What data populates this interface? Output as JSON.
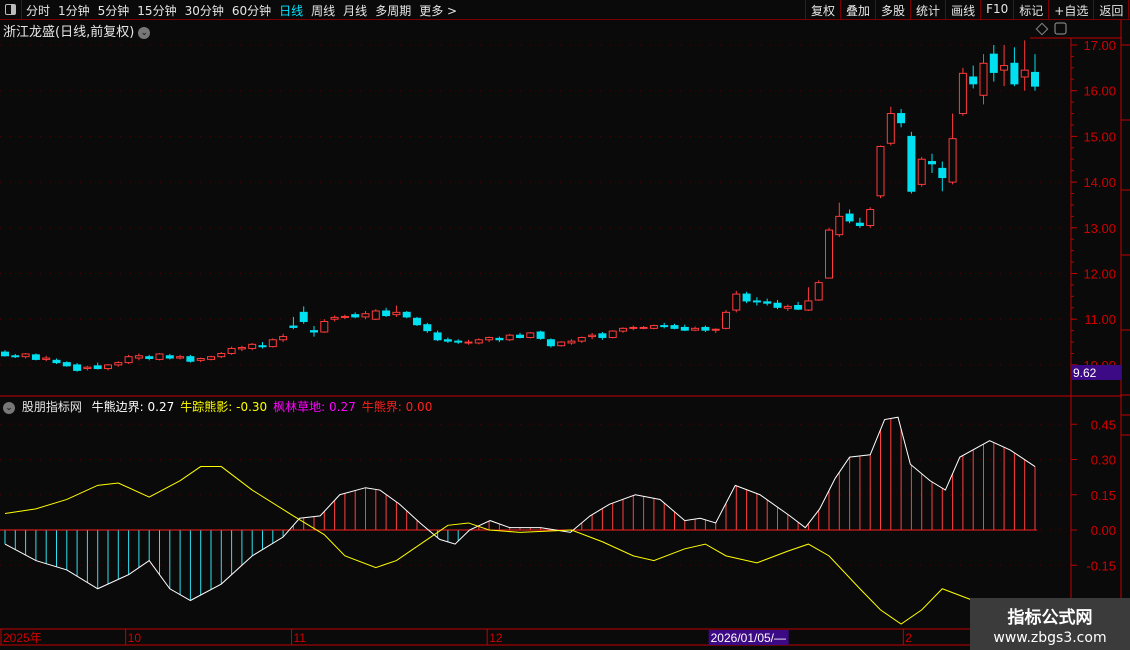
{
  "toolbar": {
    "periods": [
      "分时",
      "1分钟",
      "5分钟",
      "15分钟",
      "30分钟",
      "60分钟",
      "日线",
      "周线",
      "月线",
      "多周期",
      "更多 >"
    ],
    "active_period": "日线",
    "buttons": [
      "复权",
      "叠加",
      "多股",
      "统计",
      "画线",
      "F10",
      "标记",
      "+自选",
      "返回"
    ]
  },
  "chart": {
    "title": "浙江龙盛(日线,前复权)",
    "price_axis": [
      "17.00",
      "16.00",
      "15.00",
      "14.00",
      "13.00",
      "12.00",
      "11.00",
      "10.00"
    ],
    "price_range": [
      9.62,
      17.0
    ],
    "current_price_label": "9.62",
    "colors": {
      "up": "#ff3b3b",
      "down": "#00e0f0",
      "axis": "#c00000",
      "bg": "#0a0a0a"
    },
    "candles_ohlc": [
      [
        10.28,
        10.32,
        10.18,
        10.2
      ],
      [
        10.2,
        10.24,
        10.15,
        10.18
      ],
      [
        10.18,
        10.26,
        10.14,
        10.24
      ],
      [
        10.22,
        10.25,
        10.1,
        10.12
      ],
      [
        10.12,
        10.2,
        10.08,
        10.15
      ],
      [
        10.1,
        10.14,
        10.02,
        10.05
      ],
      [
        10.05,
        10.08,
        9.96,
        9.98
      ],
      [
        10.0,
        10.04,
        9.85,
        9.88
      ],
      [
        9.92,
        9.98,
        9.88,
        9.95
      ],
      [
        9.98,
        10.05,
        9.9,
        9.92
      ],
      [
        9.92,
        10.02,
        9.88,
        10.0
      ],
      [
        10.0,
        10.08,
        9.96,
        10.05
      ],
      [
        10.05,
        10.22,
        10.02,
        10.18
      ],
      [
        10.15,
        10.25,
        10.1,
        10.2
      ],
      [
        10.18,
        10.22,
        10.1,
        10.14
      ],
      [
        10.12,
        10.26,
        10.1,
        10.24
      ],
      [
        10.2,
        10.24,
        10.12,
        10.15
      ],
      [
        10.15,
        10.22,
        10.12,
        10.18
      ],
      [
        10.18,
        10.22,
        10.05,
        10.08
      ],
      [
        10.1,
        10.16,
        10.06,
        10.14
      ],
      [
        10.12,
        10.2,
        10.1,
        10.18
      ],
      [
        10.18,
        10.28,
        10.15,
        10.25
      ],
      [
        10.25,
        10.4,
        10.22,
        10.36
      ],
      [
        10.35,
        10.42,
        10.3,
        10.38
      ],
      [
        10.36,
        10.48,
        10.32,
        10.45
      ],
      [
        10.42,
        10.5,
        10.36,
        10.4
      ],
      [
        10.4,
        10.58,
        10.38,
        10.55
      ],
      [
        10.55,
        10.68,
        10.5,
        10.62
      ],
      [
        10.85,
        11.05,
        10.78,
        10.82
      ],
      [
        11.15,
        11.28,
        10.9,
        10.95
      ],
      [
        10.75,
        10.85,
        10.62,
        10.72
      ],
      [
        10.72,
        11.0,
        10.7,
        10.95
      ],
      [
        11.0,
        11.08,
        10.95,
        11.04
      ],
      [
        11.05,
        11.1,
        11.0,
        11.06
      ],
      [
        11.1,
        11.15,
        11.02,
        11.05
      ],
      [
        11.05,
        11.18,
        11.0,
        11.12
      ],
      [
        11.0,
        11.22,
        10.98,
        11.18
      ],
      [
        11.18,
        11.25,
        11.05,
        11.08
      ],
      [
        11.1,
        11.3,
        11.05,
        11.15
      ],
      [
        11.15,
        11.18,
        11.02,
        11.05
      ],
      [
        11.02,
        11.05,
        10.85,
        10.88
      ],
      [
        10.88,
        10.92,
        10.7,
        10.75
      ],
      [
        10.7,
        10.75,
        10.52,
        10.55
      ],
      [
        10.55,
        10.6,
        10.48,
        10.52
      ],
      [
        10.52,
        10.56,
        10.46,
        10.5
      ],
      [
        10.48,
        10.55,
        10.44,
        10.5
      ],
      [
        10.48,
        10.58,
        10.45,
        10.55
      ],
      [
        10.55,
        10.62,
        10.5,
        10.6
      ],
      [
        10.58,
        10.62,
        10.5,
        10.55
      ],
      [
        10.55,
        10.68,
        10.52,
        10.65
      ],
      [
        10.65,
        10.7,
        10.58,
        10.6
      ],
      [
        10.6,
        10.72,
        10.58,
        10.7
      ],
      [
        10.72,
        10.75,
        10.55,
        10.58
      ],
      [
        10.55,
        10.58,
        10.38,
        10.42
      ],
      [
        10.42,
        10.52,
        10.4,
        10.5
      ],
      [
        10.48,
        10.56,
        10.44,
        10.52
      ],
      [
        10.52,
        10.62,
        10.48,
        10.6
      ],
      [
        10.62,
        10.7,
        10.56,
        10.65
      ],
      [
        10.68,
        10.72,
        10.55,
        10.6
      ],
      [
        10.6,
        10.76,
        10.58,
        10.74
      ],
      [
        10.74,
        10.82,
        10.7,
        10.8
      ],
      [
        10.8,
        10.86,
        10.76,
        10.82
      ],
      [
        10.82,
        10.85,
        10.78,
        10.82
      ],
      [
        10.8,
        10.88,
        10.78,
        10.86
      ],
      [
        10.86,
        10.92,
        10.8,
        10.84
      ],
      [
        10.86,
        10.9,
        10.78,
        10.8
      ],
      [
        10.82,
        10.88,
        10.74,
        10.76
      ],
      [
        10.76,
        10.84,
        10.74,
        10.8
      ],
      [
        10.82,
        10.86,
        10.72,
        10.76
      ],
      [
        10.76,
        10.8,
        10.7,
        10.78
      ],
      [
        10.8,
        11.2,
        10.78,
        11.15
      ],
      [
        11.2,
        11.62,
        11.15,
        11.55
      ],
      [
        11.55,
        11.6,
        11.35,
        11.4
      ],
      [
        11.4,
        11.48,
        11.3,
        11.38
      ],
      [
        11.38,
        11.45,
        11.3,
        11.35
      ],
      [
        11.35,
        11.42,
        11.22,
        11.26
      ],
      [
        11.24,
        11.32,
        11.18,
        11.28
      ],
      [
        11.3,
        11.38,
        11.2,
        11.22
      ],
      [
        11.2,
        11.7,
        11.18,
        11.4
      ],
      [
        11.42,
        11.85,
        11.4,
        11.8
      ],
      [
        11.9,
        13.0,
        11.9,
        12.95
      ],
      [
        12.85,
        13.55,
        12.8,
        13.25
      ],
      [
        13.3,
        13.4,
        13.1,
        13.15
      ],
      [
        13.1,
        13.22,
        13.0,
        13.05
      ],
      [
        13.05,
        13.45,
        13.0,
        13.4
      ],
      [
        13.7,
        14.8,
        13.65,
        14.78
      ],
      [
        14.85,
        15.65,
        14.8,
        15.5
      ],
      [
        15.5,
        15.6,
        15.2,
        15.3
      ],
      [
        15.0,
        15.1,
        13.75,
        13.8
      ],
      [
        13.95,
        14.55,
        13.9,
        14.5
      ],
      [
        14.45,
        14.62,
        14.2,
        14.4
      ],
      [
        14.3,
        14.45,
        13.8,
        14.1
      ],
      [
        14.0,
        15.5,
        13.95,
        14.95
      ],
      [
        15.5,
        16.5,
        15.45,
        16.38
      ],
      [
        16.3,
        16.55,
        16.05,
        16.15
      ],
      [
        15.9,
        16.8,
        15.7,
        16.6
      ],
      [
        16.8,
        17.0,
        16.2,
        16.4
      ],
      [
        16.45,
        17.0,
        16.1,
        16.55
      ],
      [
        16.6,
        16.95,
        16.1,
        16.15
      ],
      [
        16.3,
        17.1,
        16.0,
        16.45
      ],
      [
        16.4,
        16.8,
        16.0,
        16.1
      ]
    ]
  },
  "indicator": {
    "name": "股朋指标网",
    "legend": [
      {
        "label": "牛熊边界: 0.27",
        "color": "#ffffff"
      },
      {
        "label": "牛踪熊影: -0.30",
        "color": "#ffff00"
      },
      {
        "label": "枫林草地: 0.27",
        "color": "#ff00ff"
      },
      {
        "label": "牛熊界: 0.00",
        "color": "#ff2020"
      }
    ],
    "axis": [
      "0.45",
      "0.30",
      "0.15",
      "0.00",
      "-0.15"
    ],
    "range": [
      -0.3,
      0.48
    ],
    "bull_bear_boundary": [
      [
        0,
        -0.06
      ],
      [
        3,
        -0.13
      ],
      [
        6,
        -0.17
      ],
      [
        9,
        -0.25
      ],
      [
        12,
        -0.19
      ],
      [
        14,
        -0.13
      ],
      [
        16,
        -0.25
      ],
      [
        18,
        -0.3
      ],
      [
        21,
        -0.23
      ],
      [
        24,
        -0.11
      ],
      [
        27,
        -0.03
      ],
      [
        28.6,
        0.05
      ],
      [
        30.6,
        0.06
      ],
      [
        32.5,
        0.15
      ],
      [
        35,
        0.18
      ],
      [
        36.4,
        0.17
      ],
      [
        38.3,
        0.11
      ],
      [
        40.3,
        0.03
      ],
      [
        42.2,
        -0.04
      ],
      [
        43.7,
        -0.06
      ],
      [
        45.1,
        0
      ],
      [
        47.1,
        0.04
      ],
      [
        49,
        0.01
      ],
      [
        52,
        0.01
      ],
      [
        54.9,
        -0.01
      ],
      [
        56.8,
        0.06
      ],
      [
        58.7,
        0.11
      ],
      [
        61.2,
        0.15
      ],
      [
        63.6,
        0.13
      ],
      [
        66,
        0.04
      ],
      [
        67.5,
        0.05
      ],
      [
        69,
        0.03
      ],
      [
        70.9,
        0.19
      ],
      [
        73.3,
        0.15
      ],
      [
        76.2,
        0.06
      ],
      [
        77.7,
        0.01
      ],
      [
        79.1,
        0.09
      ],
      [
        80.6,
        0.22
      ],
      [
        82,
        0.31
      ],
      [
        84,
        0.32
      ],
      [
        85.4,
        0.47
      ],
      [
        86.7,
        0.48
      ],
      [
        87.9,
        0.28
      ],
      [
        89.8,
        0.21
      ],
      [
        91.3,
        0.17
      ],
      [
        92.7,
        0.31
      ],
      [
        95.6,
        0.38
      ],
      [
        97.6,
        0.34
      ],
      [
        100,
        0.27
      ]
    ],
    "bull_trace_bear_shadow": [
      [
        0,
        0.07
      ],
      [
        3,
        0.09
      ],
      [
        6,
        0.13
      ],
      [
        9,
        0.19
      ],
      [
        11,
        0.2
      ],
      [
        14,
        0.14
      ],
      [
        17,
        0.21
      ],
      [
        19,
        0.27
      ],
      [
        21,
        0.27
      ],
      [
        24,
        0.17
      ],
      [
        28,
        0.06
      ],
      [
        31,
        -0.02
      ],
      [
        33,
        -0.11
      ],
      [
        36,
        -0.16
      ],
      [
        38,
        -0.13
      ],
      [
        41,
        -0.04
      ],
      [
        43,
        0.02
      ],
      [
        45,
        0.03
      ],
      [
        47,
        0
      ],
      [
        50,
        -0.01
      ],
      [
        55,
        0
      ],
      [
        58,
        -0.05
      ],
      [
        61,
        -0.11
      ],
      [
        63,
        -0.13
      ],
      [
        66,
        -0.08
      ],
      [
        68,
        -0.06
      ],
      [
        70,
        -0.11
      ],
      [
        73,
        -0.14
      ],
      [
        76,
        -0.09
      ],
      [
        78,
        -0.06
      ],
      [
        80,
        -0.11
      ],
      [
        83,
        -0.25
      ],
      [
        85,
        -0.34
      ],
      [
        87,
        -0.4
      ],
      [
        89,
        -0.34
      ],
      [
        91,
        -0.25
      ],
      [
        94,
        -0.3
      ]
    ]
  },
  "date_axis": {
    "labels": [
      {
        "text": "2025年",
        "i": 0
      },
      {
        "text": "10",
        "i": 12.2
      },
      {
        "text": "11",
        "i": 28.3
      },
      {
        "text": "12",
        "i": 47.3
      },
      {
        "text": "2",
        "i": 87.7
      }
    ],
    "cursor_label": "2026/01/05/—",
    "cursor_i": 68.8
  },
  "watermark": {
    "title": "指标公式网",
    "url": "www.zbgs3.com"
  }
}
